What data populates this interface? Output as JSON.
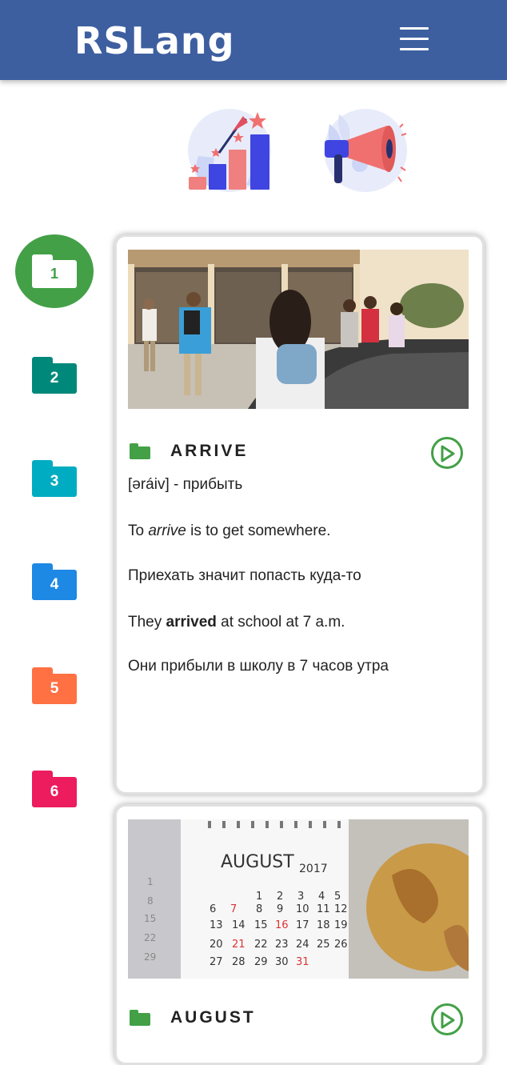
{
  "header": {
    "logo": "RSLang",
    "menu_icon": "hamburger-menu-icon",
    "background": "#3d5fa0"
  },
  "nav": {
    "statistics_icon": "statistics-chart-icon",
    "games_icon": "megaphone-icon"
  },
  "groups": [
    {
      "label": "1",
      "color": "#43a047",
      "active": true
    },
    {
      "label": "2",
      "color": "#00897b",
      "active": false
    },
    {
      "label": "3",
      "color": "#00acc1",
      "active": false
    },
    {
      "label": "4",
      "color": "#1e88e5",
      "active": false
    },
    {
      "label": "5",
      "color": "#ff7043",
      "active": false
    },
    {
      "label": "6",
      "color": "#ec1c5e",
      "active": false
    }
  ],
  "cards": [
    {
      "word": "ARRIVE",
      "transcription": "[əráiv] - прибыть",
      "meaning_prefix": "To ",
      "meaning_word": "arrive",
      "meaning_suffix": " is to get somewhere.",
      "meaning_translate": "Приехать значит попасть куда-то",
      "example_prefix": "They ",
      "example_word": "arrived",
      "example_suffix": " at school at 7 a.m.",
      "example_translate": "Они прибыли в школу в 7 часов утра"
    },
    {
      "word": "AUGUST",
      "calendar_month": "AUGUST",
      "calendar_year": "2017"
    }
  ]
}
